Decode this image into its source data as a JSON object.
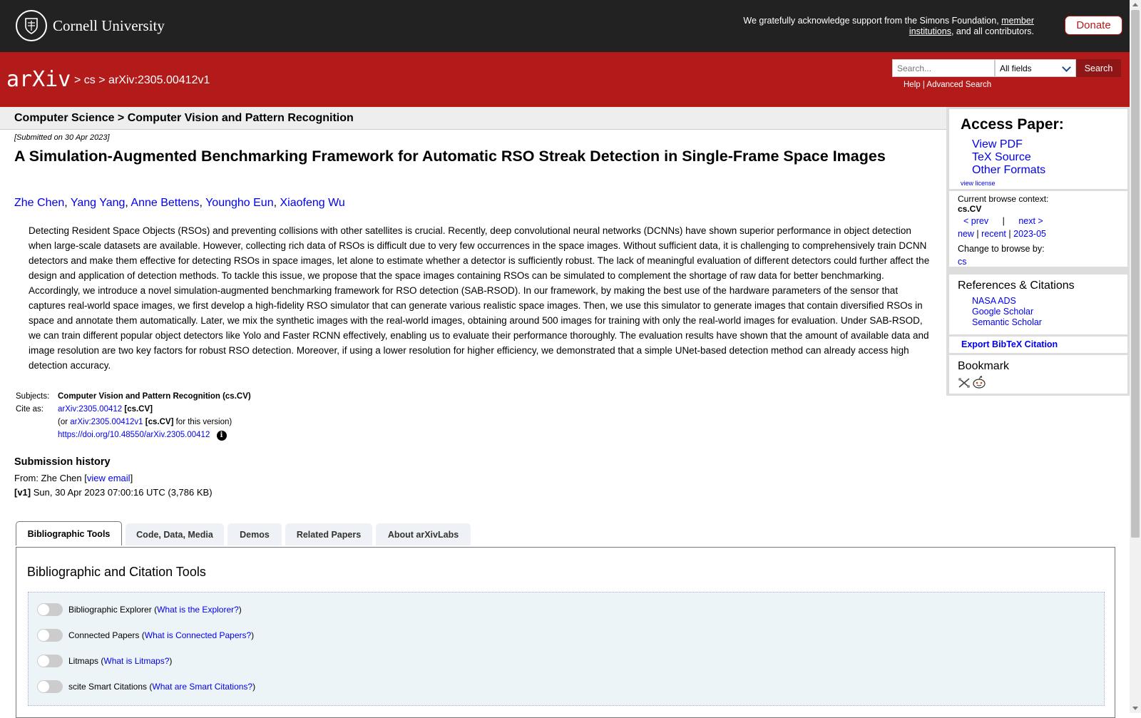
{
  "header": {
    "university": "Cornell University",
    "support_text": "We gratefully acknowledge support from the Simons Foundation,",
    "member_link": "member institutions",
    "support_suffix": ", and all contributors.",
    "donate_label": "Donate"
  },
  "navbar": {
    "logo": "arXiv",
    "crumb_sep": ">",
    "crumb_cs": "cs",
    "crumb_id": "arXiv:2305.00412v1",
    "search_placeholder": "Search...",
    "field_selected": "All fields",
    "search_button": "Search",
    "help_link": "Help",
    "links_sep": "|",
    "advanced_link": "Advanced Search"
  },
  "subject_header": "Computer Science > Computer Vision and Pattern Recognition",
  "paper": {
    "submitted": "[Submitted on 30 Apr 2023]",
    "title": "A Simulation-Augmented Benchmarking Framework for Automatic RSO Streak Detection in Single-Frame Space Images",
    "authors": [
      "Zhe Chen",
      "Yang Yang",
      "Anne Bettens",
      "Youngho Eun",
      "Xiaofeng Wu"
    ],
    "author_sep": ", ",
    "abstract": "Detecting Resident Space Objects (RSOs) and preventing collisions with other satellites is crucial. Recently, deep convolutional neural networks (DCNNs) have shown superior performance in object detection when large-scale datasets are available. However, collecting rich data of RSOs is difficult due to very few occurrences in the space images. Without sufficient data, it is challenging to comprehensively train DCNN detectors and make them effective for detecting RSOs in space images, let alone to estimate whether a detector is sufficiently robust. The lack of meaningful evaluation of different detectors could further affect the design and application of detection methods. To tackle this issue, we propose that the space images containing RSOs can be simulated to complement the shortage of raw data for better benchmarking. Accordingly, we introduce a novel simulation-augmented benchmarking framework for RSO detection (SAB-RSOD). In our framework, by making the best use of the hardware parameters of the sensor that captures real-world space images, we first develop a high-fidelity RSO simulator that can generate various realistic space images. Then, we use this simulator to generate images that contain diversified RSOs in space and annotate them automatically. Later, we mix the synthetic images with the real-world images, obtaining around 500 images for training with only the real-world images for evaluation. Under SAB-RSOD, we can train different popular object detectors like Yolo and Faster RCNN effectively, enabling us to evaluate their performance thoroughly. The evaluation results have shown that the amount of available data and image resolution are two key factors for robust RSO detection. Moreover, if using a lower resolution for higher efficiency, we demonstrated that a simple UNet-based detection method can already access high detection accuracy."
  },
  "meta": {
    "subjects_label": "Subjects:",
    "subjects_value": "Computer Vision and Pattern Recognition (cs.CV)",
    "cite_label": "Cite as:",
    "cite_link": "arXiv:2305.00412",
    "cite_tag": "[cs.CV]",
    "or_open": "(or",
    "version_link": "arXiv:2305.00412v1",
    "version_tag": "[cs.CV]",
    "version_suffix": "for this version)",
    "doi_link": "https://doi.org/10.48550/arXiv.2305.00412",
    "info_glyph": "i"
  },
  "history": {
    "heading": "Submission history",
    "from_prefix": "From: Zhe Chen [",
    "view_email": "view email",
    "from_suffix": "]",
    "v1_label": "[v1]",
    "v1_text": "Sun, 30 Apr 2023 07:00:16 UTC (3,786 KB)"
  },
  "tabs": [
    "Bibliographic Tools",
    "Code, Data, Media",
    "Demos",
    "Related Papers",
    "About arXivLabs"
  ],
  "tools": {
    "heading": "Bibliographic and Citation Tools",
    "items": [
      {
        "label": "Bibliographic Explorer",
        "link": "What is the Explorer?"
      },
      {
        "label": "Connected Papers",
        "link": "What is Connected Papers?"
      },
      {
        "label": "Litmaps",
        "link": "What is Litmaps?"
      },
      {
        "label": "scite Smart Citations",
        "link": "What are Smart Citations?"
      }
    ]
  },
  "sidebar": {
    "access_title": "Access Paper:",
    "view_pdf": "View PDF",
    "tex_source": "TeX Source",
    "other_formats": "Other Formats",
    "view_license": "view license",
    "browse_context_label": "Current browse context:",
    "browse_context": "cs.CV",
    "prev": "< prev",
    "pipe": "|",
    "next": "next >",
    "new": "new",
    "recent": "recent",
    "month": "2023-05",
    "change_browse": "Change to browse by:",
    "browse_cs": "cs",
    "refs_title": "References & Citations",
    "nasa": "NASA ADS",
    "google": "Google Scholar",
    "semantic": "Semantic Scholar",
    "export_bibtex": "Export BibTeX Citation",
    "bookmark_title": "Bookmark"
  },
  "colors": {
    "arxiv_red": "#b31b1b",
    "header_dark": "#222222",
    "link_blue": "#0000ee"
  }
}
